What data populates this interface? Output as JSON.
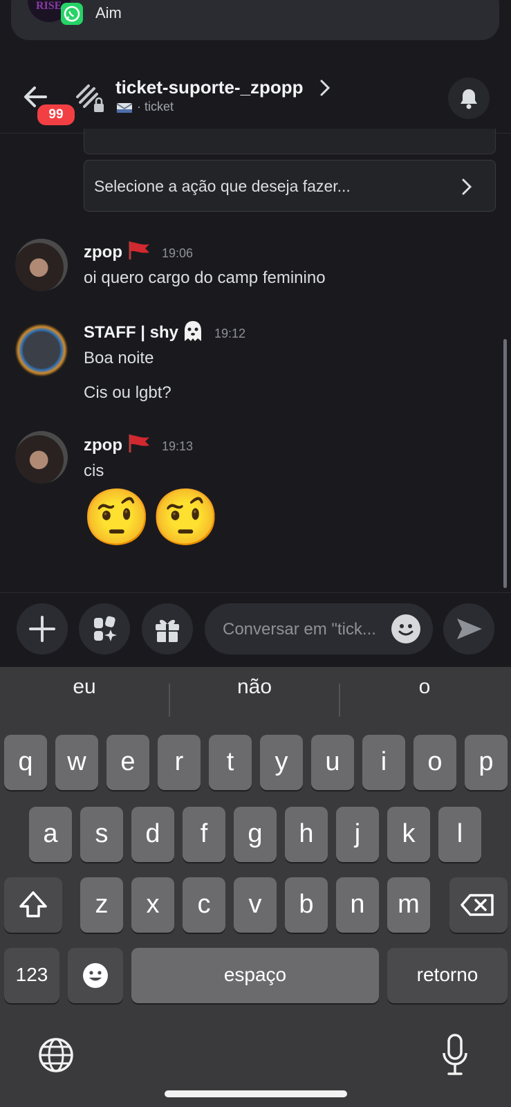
{
  "notification": {
    "app_title": "Aim",
    "avatar_text": "RISE"
  },
  "header": {
    "badge_count": "99",
    "channel_name": "ticket-suporte-_zpopp",
    "channel_sub": "· ticket"
  },
  "select_menu": {
    "placeholder": "Selecione a ação que deseja fazer..."
  },
  "messages": [
    {
      "author": "zpop",
      "author_icon": "red-flag-icon",
      "time": "19:06",
      "lines": [
        "oi quero cargo do camp feminino"
      ]
    },
    {
      "author": "STAFF | shy",
      "author_icon": "ghost-icon",
      "time": "19:12",
      "lines": [
        "Boa noite",
        "Cis ou lgbt?"
      ]
    },
    {
      "author": "zpop",
      "author_icon": "red-flag-icon",
      "time": "19:13",
      "lines": [
        "cis"
      ],
      "emojis": "🤨🤨"
    }
  ],
  "composer": {
    "placeholder": "Conversar em \"tick..."
  },
  "keyboard": {
    "suggestions": [
      "eu",
      "não",
      "o"
    ],
    "row1": [
      "q",
      "w",
      "e",
      "r",
      "t",
      "y",
      "u",
      "i",
      "o",
      "p"
    ],
    "row2": [
      "a",
      "s",
      "d",
      "f",
      "g",
      "h",
      "j",
      "k",
      "l"
    ],
    "row3": [
      "z",
      "x",
      "c",
      "v",
      "b",
      "n",
      "m"
    ],
    "numbers_label": "123",
    "space_label": "espaço",
    "return_label": "retorno"
  },
  "colors": {
    "background": "#1a1a1e",
    "badge": "#f23f43",
    "keyboard": "#3a3a3c",
    "key": "#6b6b6e"
  }
}
